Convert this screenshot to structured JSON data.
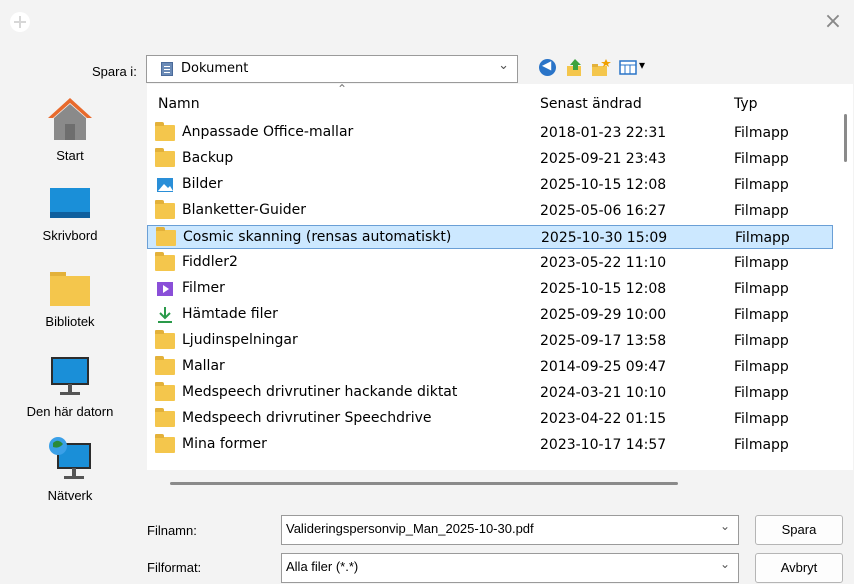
{
  "header": {
    "close_symbol": "×"
  },
  "location": {
    "label": "Spara i:",
    "value": "Dokument"
  },
  "toolbar": {
    "view_symbol": "▾"
  },
  "sidebar": {
    "items": [
      {
        "label": "Start"
      },
      {
        "label": "Skrivbord"
      },
      {
        "label": "Bibliotek"
      },
      {
        "label": "Den här datorn"
      },
      {
        "label": "Nätverk"
      }
    ]
  },
  "columns": {
    "name": "Namn",
    "date": "Senast ändrad",
    "type": "Typ"
  },
  "files": [
    {
      "name": "Anpassade Office-mallar",
      "date": "2018-01-23 22:31",
      "type": "Filmapp",
      "icon": "folder-icon"
    },
    {
      "name": "Backup",
      "date": "2025-09-21 23:43",
      "type": "Filmapp",
      "icon": "folder-icon"
    },
    {
      "name": "Bilder",
      "date": "2025-10-15 12:08",
      "type": "Filmapp",
      "icon": "pictures-icon"
    },
    {
      "name": "Blanketter-Guider",
      "date": "2025-05-06 16:27",
      "type": "Filmapp",
      "icon": "folder-icon"
    },
    {
      "name": "Cosmic skanning (rensas automatiskt)",
      "date": "2025-10-30 15:09",
      "type": "Filmapp",
      "icon": "folder-icon",
      "selected": true
    },
    {
      "name": "Fiddler2",
      "date": "2023-05-22 11:10",
      "type": "Filmapp",
      "icon": "folder-icon"
    },
    {
      "name": "Filmer",
      "date": "2025-10-15 12:08",
      "type": "Filmapp",
      "icon": "videos-icon"
    },
    {
      "name": "Hämtade filer",
      "date": "2025-09-29 10:00",
      "type": "Filmapp",
      "icon": "download-icon"
    },
    {
      "name": "Ljudinspelningar",
      "date": "2025-09-17 13:58",
      "type": "Filmapp",
      "icon": "folder-icon"
    },
    {
      "name": "Mallar",
      "date": "2014-09-25 09:47",
      "type": "Filmapp",
      "icon": "folder-icon"
    },
    {
      "name": "Medspeech drivrutiner hackande diktat",
      "date": "2024-03-21 10:10",
      "type": "Filmapp",
      "icon": "folder-icon"
    },
    {
      "name": "Medspeech drivrutiner Speechdrive",
      "date": "2023-04-22 01:15",
      "type": "Filmapp",
      "icon": "folder-icon"
    },
    {
      "name": "Mina former",
      "date": "2023-10-17 14:57",
      "type": "Filmapp",
      "icon": "folder-icon"
    }
  ],
  "filename": {
    "label": "Filnamn:",
    "value": "Valideringspersonvip_Man_2025-10-30.pdf"
  },
  "fileformat": {
    "label": "Filformat:",
    "value": "Alla filer (*.*)"
  },
  "buttons": {
    "save": "Spara",
    "cancel": "Avbryt"
  },
  "colors": {
    "accent": "#2a74c8",
    "selection": "#cce8ff",
    "folder": "#f4c64c"
  }
}
